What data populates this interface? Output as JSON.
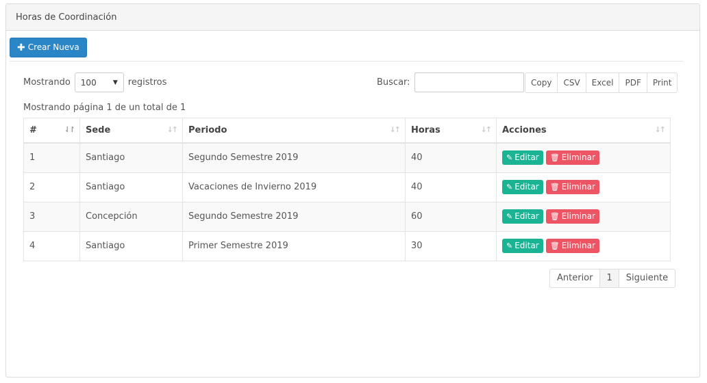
{
  "panel": {
    "title": "Horas de Coordinación"
  },
  "create_button": {
    "label": "Crear Nueva",
    "icon": "plus-icon",
    "color": "#2b86c8"
  },
  "length": {
    "prefix": "Mostrando",
    "value": "100",
    "suffix": "registros"
  },
  "search": {
    "label": "Buscar:",
    "value": ""
  },
  "export_buttons": [
    "Copy",
    "CSV",
    "Excel",
    "PDF",
    "Print"
  ],
  "info": "Mostrando página 1 de un total de 1",
  "table": {
    "headers": [
      "#",
      "Sede",
      "Periodo",
      "Horas",
      "Acciones"
    ],
    "rows": [
      {
        "id": "1",
        "sede": "Santiago",
        "periodo": "Segundo Semestre 2019",
        "horas": "40"
      },
      {
        "id": "2",
        "sede": "Santiago",
        "periodo": "Vacaciones de Invierno 2019",
        "horas": "40"
      },
      {
        "id": "3",
        "sede": "Concepción",
        "periodo": "Segundo Semestre 2019",
        "horas": "60"
      },
      {
        "id": "4",
        "sede": "Santiago",
        "periodo": "Primer Semestre 2019",
        "horas": "30"
      }
    ],
    "edit_label": "Editar",
    "delete_label": "Eliminar"
  },
  "pagination": {
    "prev": "Anterior",
    "current": "1",
    "next": "Siguiente"
  },
  "colors": {
    "edit": "#1ab394",
    "delete": "#ed5565"
  }
}
